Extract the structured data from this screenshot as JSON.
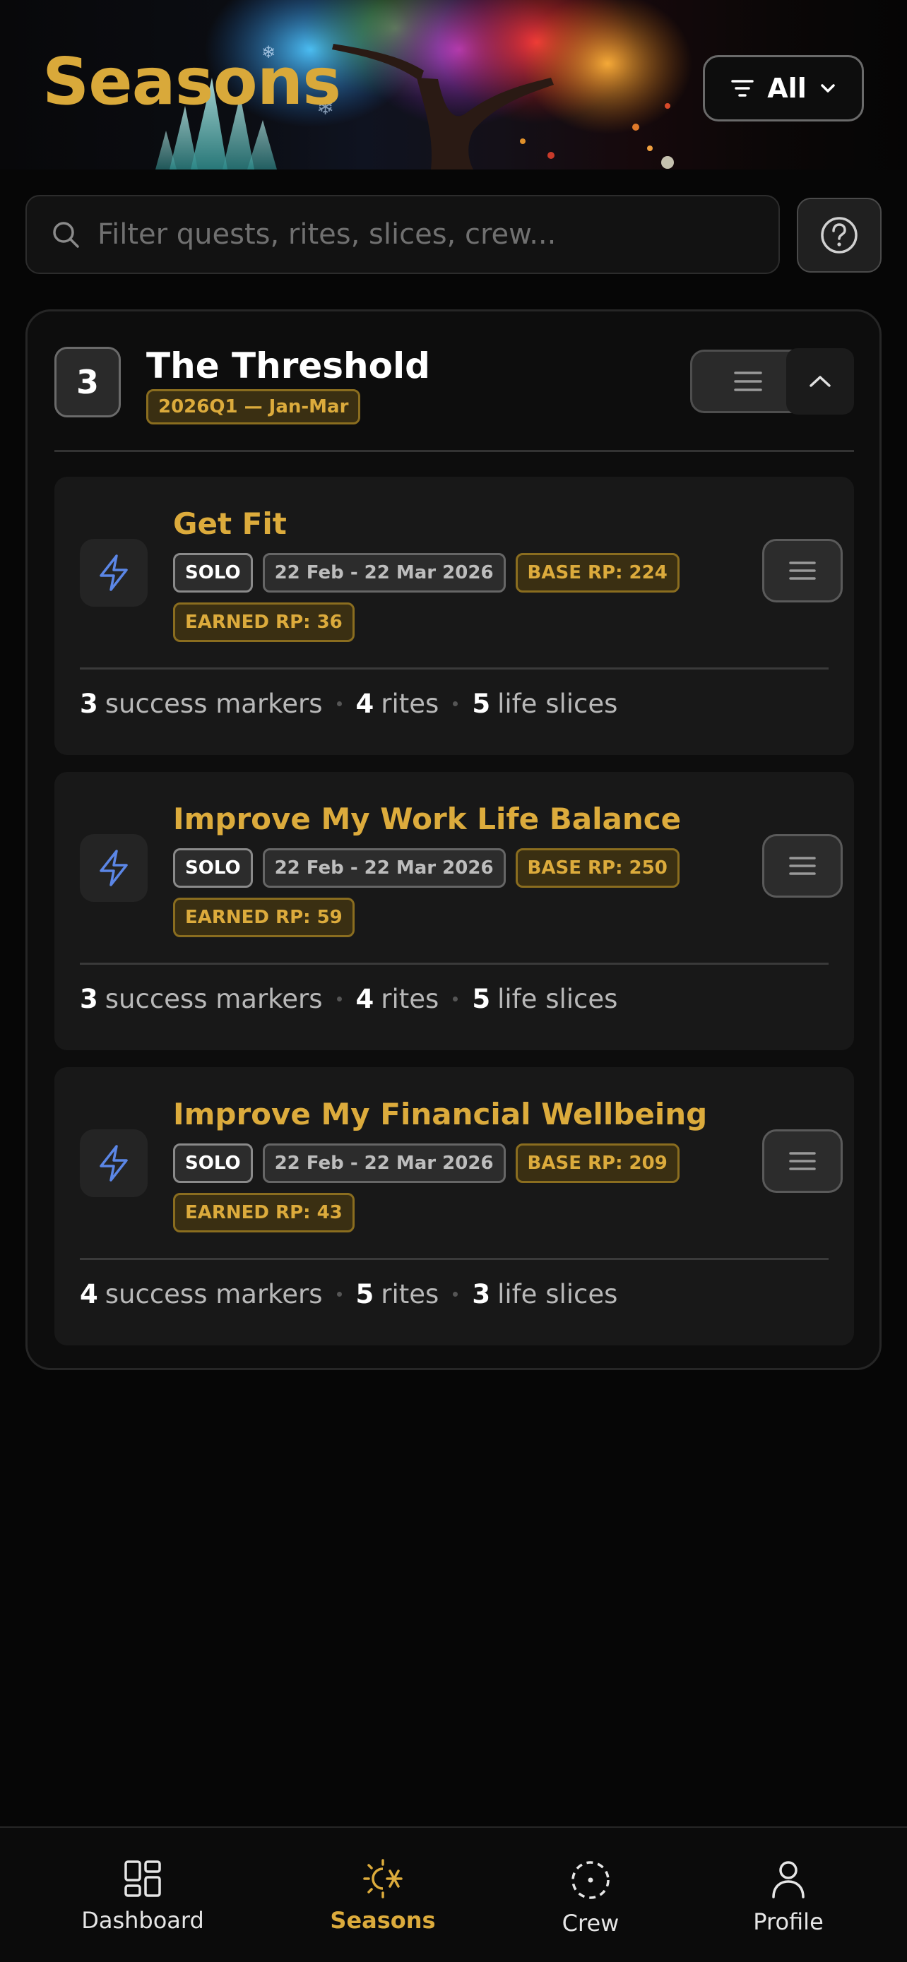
{
  "header": {
    "title": "Seasons",
    "filter_label": "All"
  },
  "search": {
    "placeholder": "Filter quests, rites, slices, crew..."
  },
  "season": {
    "number": "3",
    "title": "The Threshold",
    "period": "2026Q1 — Jan-Mar"
  },
  "quests": [
    {
      "title": "Get Fit",
      "type": "SOLO",
      "dates": "22 Feb - 22 Mar 2026",
      "base_rp": "BASE RP: 224",
      "earned_rp": "EARNED RP: 36",
      "success_markers": "3",
      "success_markers_label": "success markers",
      "rites": "4",
      "rites_label": "rites",
      "life_slices": "5",
      "life_slices_label": "life slices"
    },
    {
      "title": "Improve My Work Life Balance",
      "type": "SOLO",
      "dates": "22 Feb - 22 Mar 2026",
      "base_rp": "BASE RP: 250",
      "earned_rp": "EARNED RP: 59",
      "success_markers": "3",
      "success_markers_label": "success markers",
      "rites": "4",
      "rites_label": "rites",
      "life_slices": "5",
      "life_slices_label": "life slices"
    },
    {
      "title": "Improve My Financial Wellbeing",
      "type": "SOLO",
      "dates": "22 Feb - 22 Mar 2026",
      "base_rp": "BASE RP: 209",
      "earned_rp": "EARNED RP: 43",
      "success_markers": "4",
      "success_markers_label": "success markers",
      "rites": "5",
      "rites_label": "rites",
      "life_slices": "3",
      "life_slices_label": "life slices"
    }
  ],
  "nav": {
    "items": [
      {
        "label": "Dashboard",
        "icon": "dashboard-grid-icon"
      },
      {
        "label": "Seasons",
        "icon": "seasons-sun-snow-icon",
        "active": true
      },
      {
        "label": "Crew",
        "icon": "crew-dashed-circle-icon"
      },
      {
        "label": "Profile",
        "icon": "profile-person-icon"
      }
    ]
  },
  "colors": {
    "accent_gold": "#dcab3c",
    "background": "#060606",
    "card": "#181818",
    "quest_icon_blue": "#5b86e6"
  }
}
